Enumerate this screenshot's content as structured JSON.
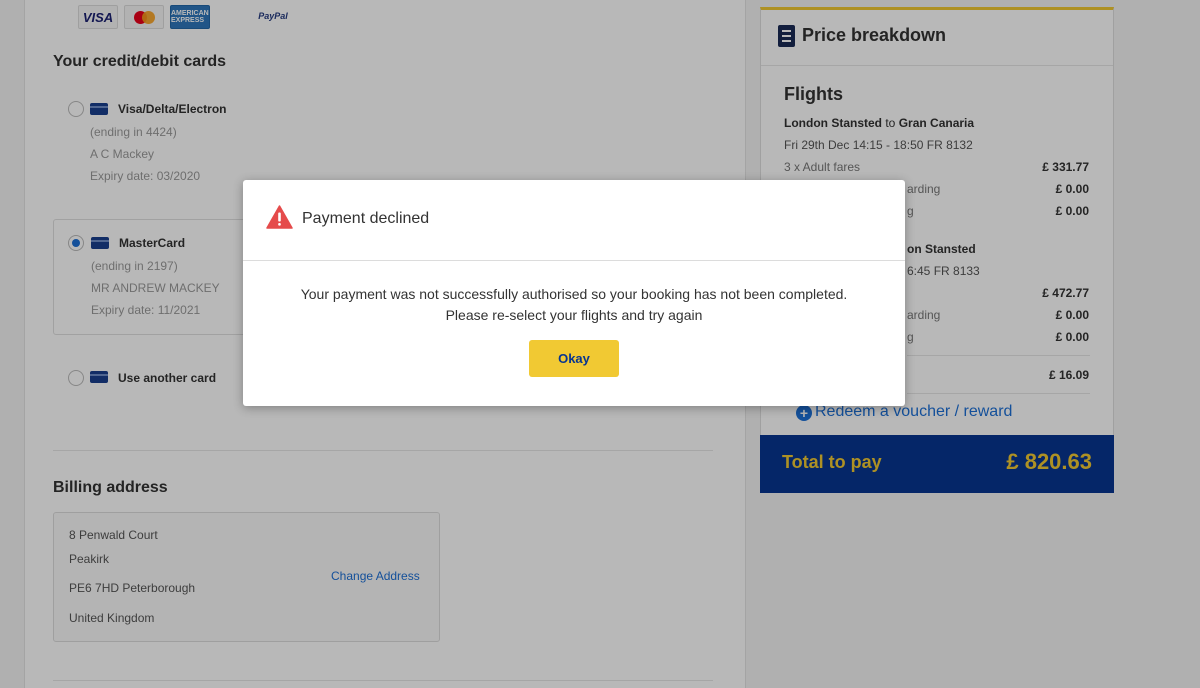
{
  "payment_logos": {
    "visa": "VISA",
    "amex": "AMERICAN EXPRESS",
    "paypal": "PayPal"
  },
  "cards": {
    "section_title": "Your credit/debit cards",
    "items": [
      {
        "type": "Visa/Delta/Electron",
        "ending": "(ending in 4424)",
        "holder": "A C Mackey",
        "expiry": "Expiry date: 03/2020",
        "selected": false
      },
      {
        "type": "MasterCard",
        "ending": "(ending in 2197)",
        "holder": "MR ANDREW MACKEY",
        "expiry": "Expiry date: 11/2021",
        "selected": true
      }
    ],
    "other_card_label": "Use another card"
  },
  "billing": {
    "title": "Billing address",
    "lines": [
      "8 Penwald Court",
      "Peakirk",
      "PE6 7HD Peterborough",
      "United Kingdom"
    ],
    "change_label": "Change Address"
  },
  "price_breakdown": {
    "title": "Price breakdown",
    "flights_heading": "Flights",
    "outbound": {
      "from": "London Stansted",
      "to_word": "to",
      "to": "Gran Canaria",
      "details": "Fri 29th Dec 14:15 - 18:50 FR 8132",
      "fares_label": "3 x Adult fares",
      "fares_amount": "£ 331.77",
      "row2_label_partial": "arding",
      "row2_amount": "£ 0.00",
      "row3_label_partial": "g",
      "row3_amount": "£ 0.00"
    },
    "return": {
      "route_partial": "on Stansted",
      "details_partial": "6:45 FR 8133",
      "fares_amount": "£ 472.77",
      "row2_label_partial": "arding",
      "row2_amount": "£ 0.00",
      "row3_label_partial": "g",
      "row3_amount": "£ 0.00"
    },
    "extra_amount": "£ 16.09",
    "voucher_label": "Redeem a voucher / reward",
    "total_label": "Total to pay",
    "total_value": "£ 820.63"
  },
  "modal": {
    "title": "Payment declined",
    "message_line1": "Your payment was not successfully authorised so your booking has not been completed.",
    "message_line2": "Please re-select your flights and try again",
    "ok_label": "Okay"
  },
  "colors": {
    "brand_blue": "#073590",
    "brand_yellow": "#f1c933",
    "link_blue": "#1c6fd6",
    "warning_red": "#e54b4b"
  }
}
